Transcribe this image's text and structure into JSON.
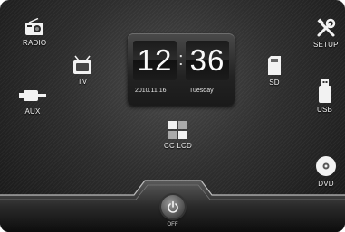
{
  "icons": {
    "radio": "RADIO",
    "tv": "TV",
    "aux": "AUX",
    "cclcd": "CC LCD",
    "sd": "SD",
    "usb": "USB",
    "setup": "SETUP",
    "dvd": "DVD"
  },
  "clock": {
    "hours": "12",
    "minutes": "36",
    "date": "2010.11.16",
    "weekday": "Tuesday"
  },
  "dock": {
    "off_label": "OFF"
  }
}
